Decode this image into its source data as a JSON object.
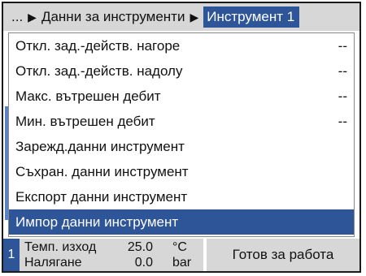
{
  "header": {
    "ellipsis": "...",
    "crumb": "Данни за инструменти",
    "active": "Инструмент 1"
  },
  "menu": {
    "items": [
      {
        "label": "Откл. зад.-действ. нагоре",
        "value": "--"
      },
      {
        "label": "Откл. зад.-действ. надолу",
        "value": "--"
      },
      {
        "label": "Макс. вътрешен дебит",
        "value": "--"
      },
      {
        "label": "Мин. вътрешен дебит",
        "value": "--"
      },
      {
        "label": "Зарежд.данни инструмент",
        "value": ""
      },
      {
        "label": "Съхран. данни инструмент",
        "value": ""
      },
      {
        "label": "Експорт данни инструмент",
        "value": ""
      },
      {
        "label": "Импор данни инструмент",
        "value": ""
      }
    ],
    "selected_index": 7
  },
  "status": {
    "number": "1",
    "rows": [
      {
        "label": "Темп. изход",
        "value": "25.0",
        "unit": "°C"
      },
      {
        "label": "Налягане",
        "value": "0.0",
        "unit": "bar"
      }
    ],
    "ready": "Готов за работа"
  },
  "colors": {
    "accent": "#2e5597",
    "panel": "#d7d7d7"
  }
}
